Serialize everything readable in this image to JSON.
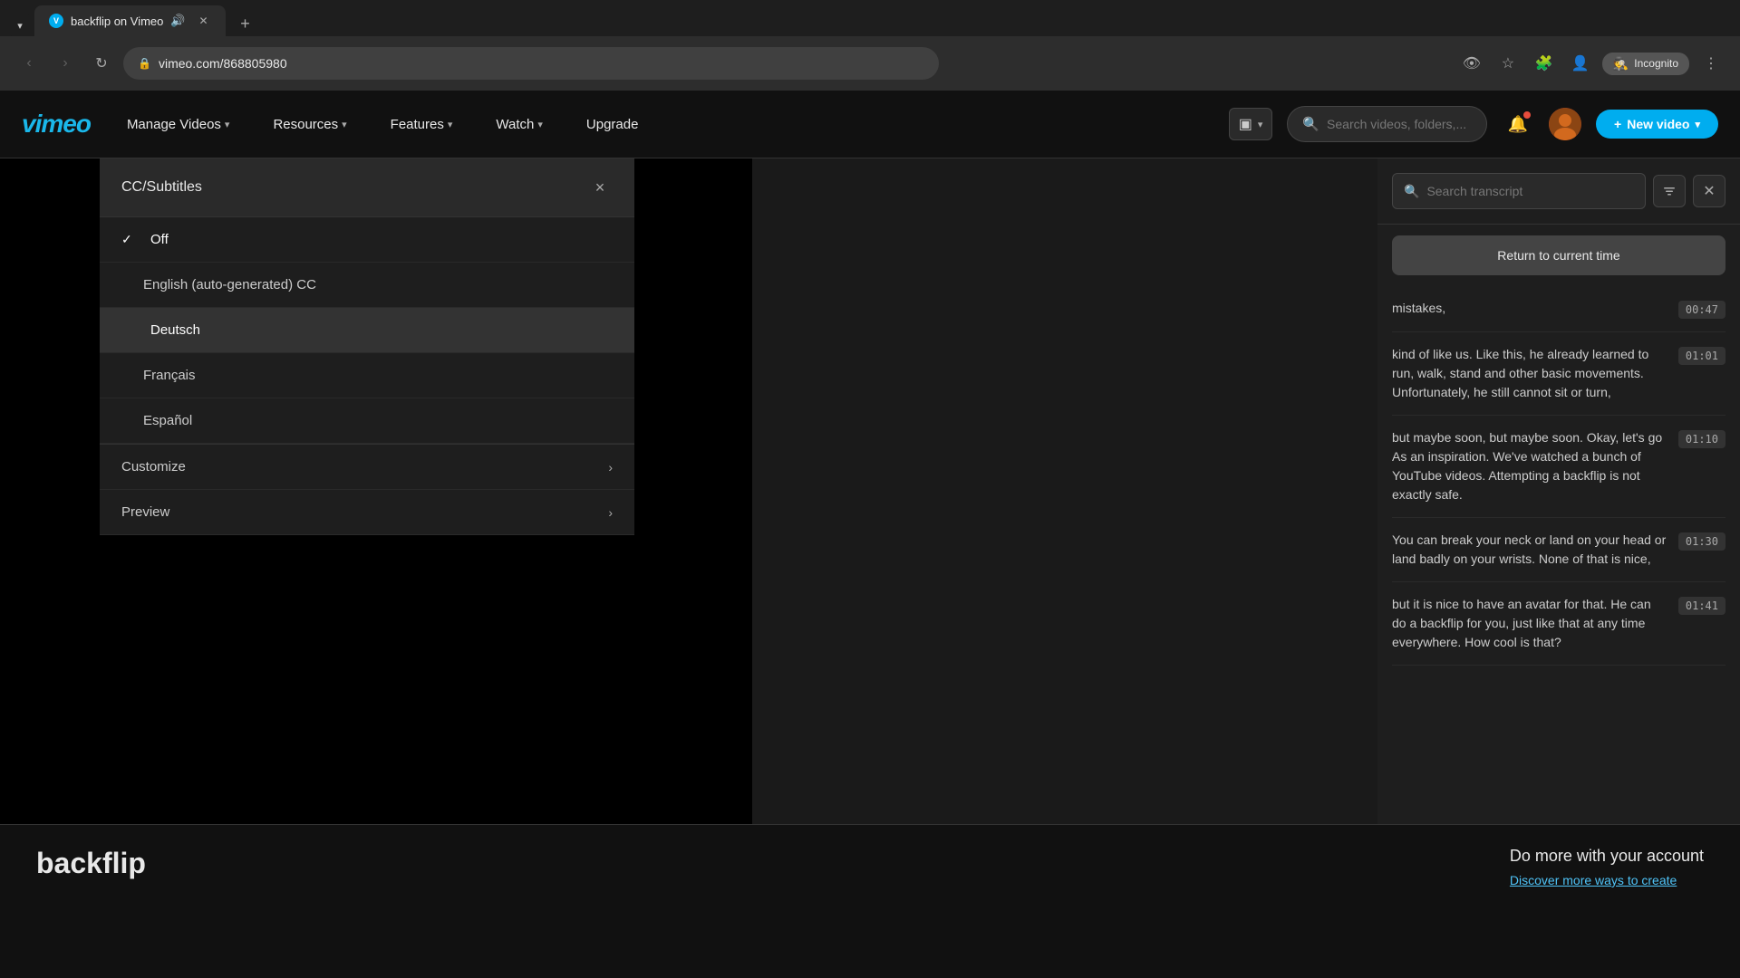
{
  "browser": {
    "tab_favicon": "V",
    "tab_title": "backflip on Vimeo",
    "tab_add_label": "+",
    "nav_back_label": "‹",
    "nav_forward_label": "›",
    "nav_refresh_label": "↻",
    "address": "vimeo.com/868805980",
    "incognito_label": "Incognito"
  },
  "header": {
    "logo": "vimeo",
    "nav_items": [
      {
        "label": "Manage Videos",
        "has_dropdown": true
      },
      {
        "label": "Resources",
        "has_dropdown": true
      },
      {
        "label": "Features",
        "has_dropdown": true
      },
      {
        "label": "Watch",
        "has_dropdown": true
      },
      {
        "label": "Upgrade",
        "has_dropdown": false
      }
    ],
    "search_placeholder": "Search videos, folders,...",
    "new_video_label": "New video",
    "new_video_icon": "+"
  },
  "cc_panel": {
    "title": "CC/Subtitles",
    "close_icon": "×",
    "items": [
      {
        "label": "Off",
        "is_checked": true,
        "indent": false
      },
      {
        "label": "English (auto-generated) CC",
        "is_checked": false,
        "indent": true
      },
      {
        "label": "Deutsch",
        "is_checked": false,
        "indent": true,
        "highlighted": true
      },
      {
        "label": "Français",
        "is_checked": false,
        "indent": true
      },
      {
        "label": "Español",
        "is_checked": false,
        "indent": true
      }
    ],
    "expandable_items": [
      {
        "label": "Customize"
      },
      {
        "label": "Preview"
      }
    ]
  },
  "transcript": {
    "search_placeholder": "Search transcript",
    "return_btn_label": "Return to current time",
    "entries": [
      {
        "text": "mistakes,",
        "time": "00:47"
      },
      {
        "text": "kind of like us. Like this, he already learned to run, walk, stand and other basic movements. Unfortunately, he still cannot sit or turn,",
        "time": "01:01"
      },
      {
        "text": "but maybe soon, but maybe soon. Okay, let's go As an inspiration. We've watched a bunch of YouTube videos. Attempting a backflip is not exactly safe.",
        "time": "01:10"
      },
      {
        "text": "You can break your neck or land on your head or land badly on your wrists. None of that is nice,",
        "time": "01:30"
      },
      {
        "text": "but it is nice to have an avatar for that. He can do a backflip for you, just like that at any time everywhere. How cool is that?",
        "time": "01:41"
      }
    ]
  },
  "bottom": {
    "video_title": "backflip",
    "do_more_title": "Do more with your account",
    "do_more_link": "Discover more ways to create"
  }
}
